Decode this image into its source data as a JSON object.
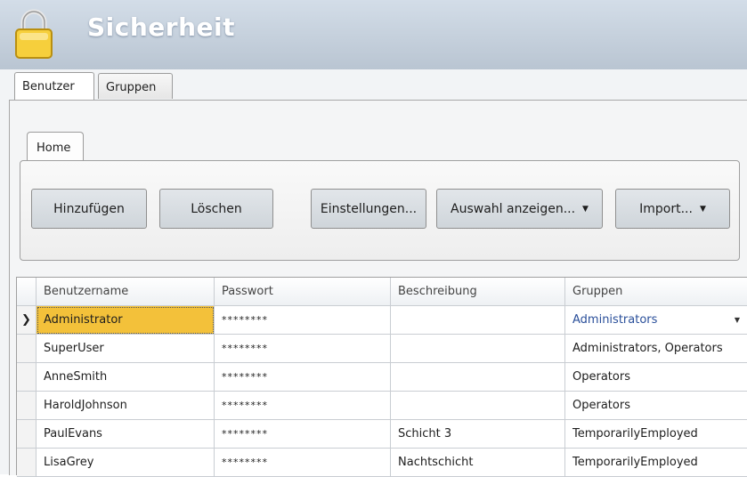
{
  "header": {
    "title": "Sicherheit",
    "icon": "lock-icon"
  },
  "tabs": [
    {
      "label": "Benutzer",
      "active": true
    },
    {
      "label": "Gruppen",
      "active": false
    }
  ],
  "ribbon": {
    "tab_label": "Home",
    "buttons": {
      "add": "Hinzufügen",
      "delete": "Löschen",
      "settings": "Einstellungen...",
      "show_selection": "Auswahl anzeigen...",
      "import": "Import..."
    }
  },
  "grid": {
    "columns": [
      "Benutzername",
      "Passwort",
      "Beschreibung",
      "Gruppen"
    ],
    "rows": [
      {
        "name": "Administrator",
        "password": "********",
        "description": "",
        "groups": "Administrators"
      },
      {
        "name": "SuperUser",
        "password": "********",
        "description": "",
        "groups": "Administrators, Operators"
      },
      {
        "name": "AnneSmith",
        "password": "********",
        "description": "",
        "groups": "Operators"
      },
      {
        "name": "HaroldJohnson",
        "password": "********",
        "description": "",
        "groups": "Operators"
      },
      {
        "name": "PaulEvans",
        "password": "********",
        "description": "Schicht 3",
        "groups": "TemporarilyEmployed"
      },
      {
        "name": "LisaGrey",
        "password": "********",
        "description": "Nachtschicht",
        "groups": "TemporarilyEmployed"
      }
    ]
  },
  "colors": {
    "selection": "#f3c13a",
    "header_bg": "#c5d0dc",
    "group_link": "#2a4f9a"
  }
}
